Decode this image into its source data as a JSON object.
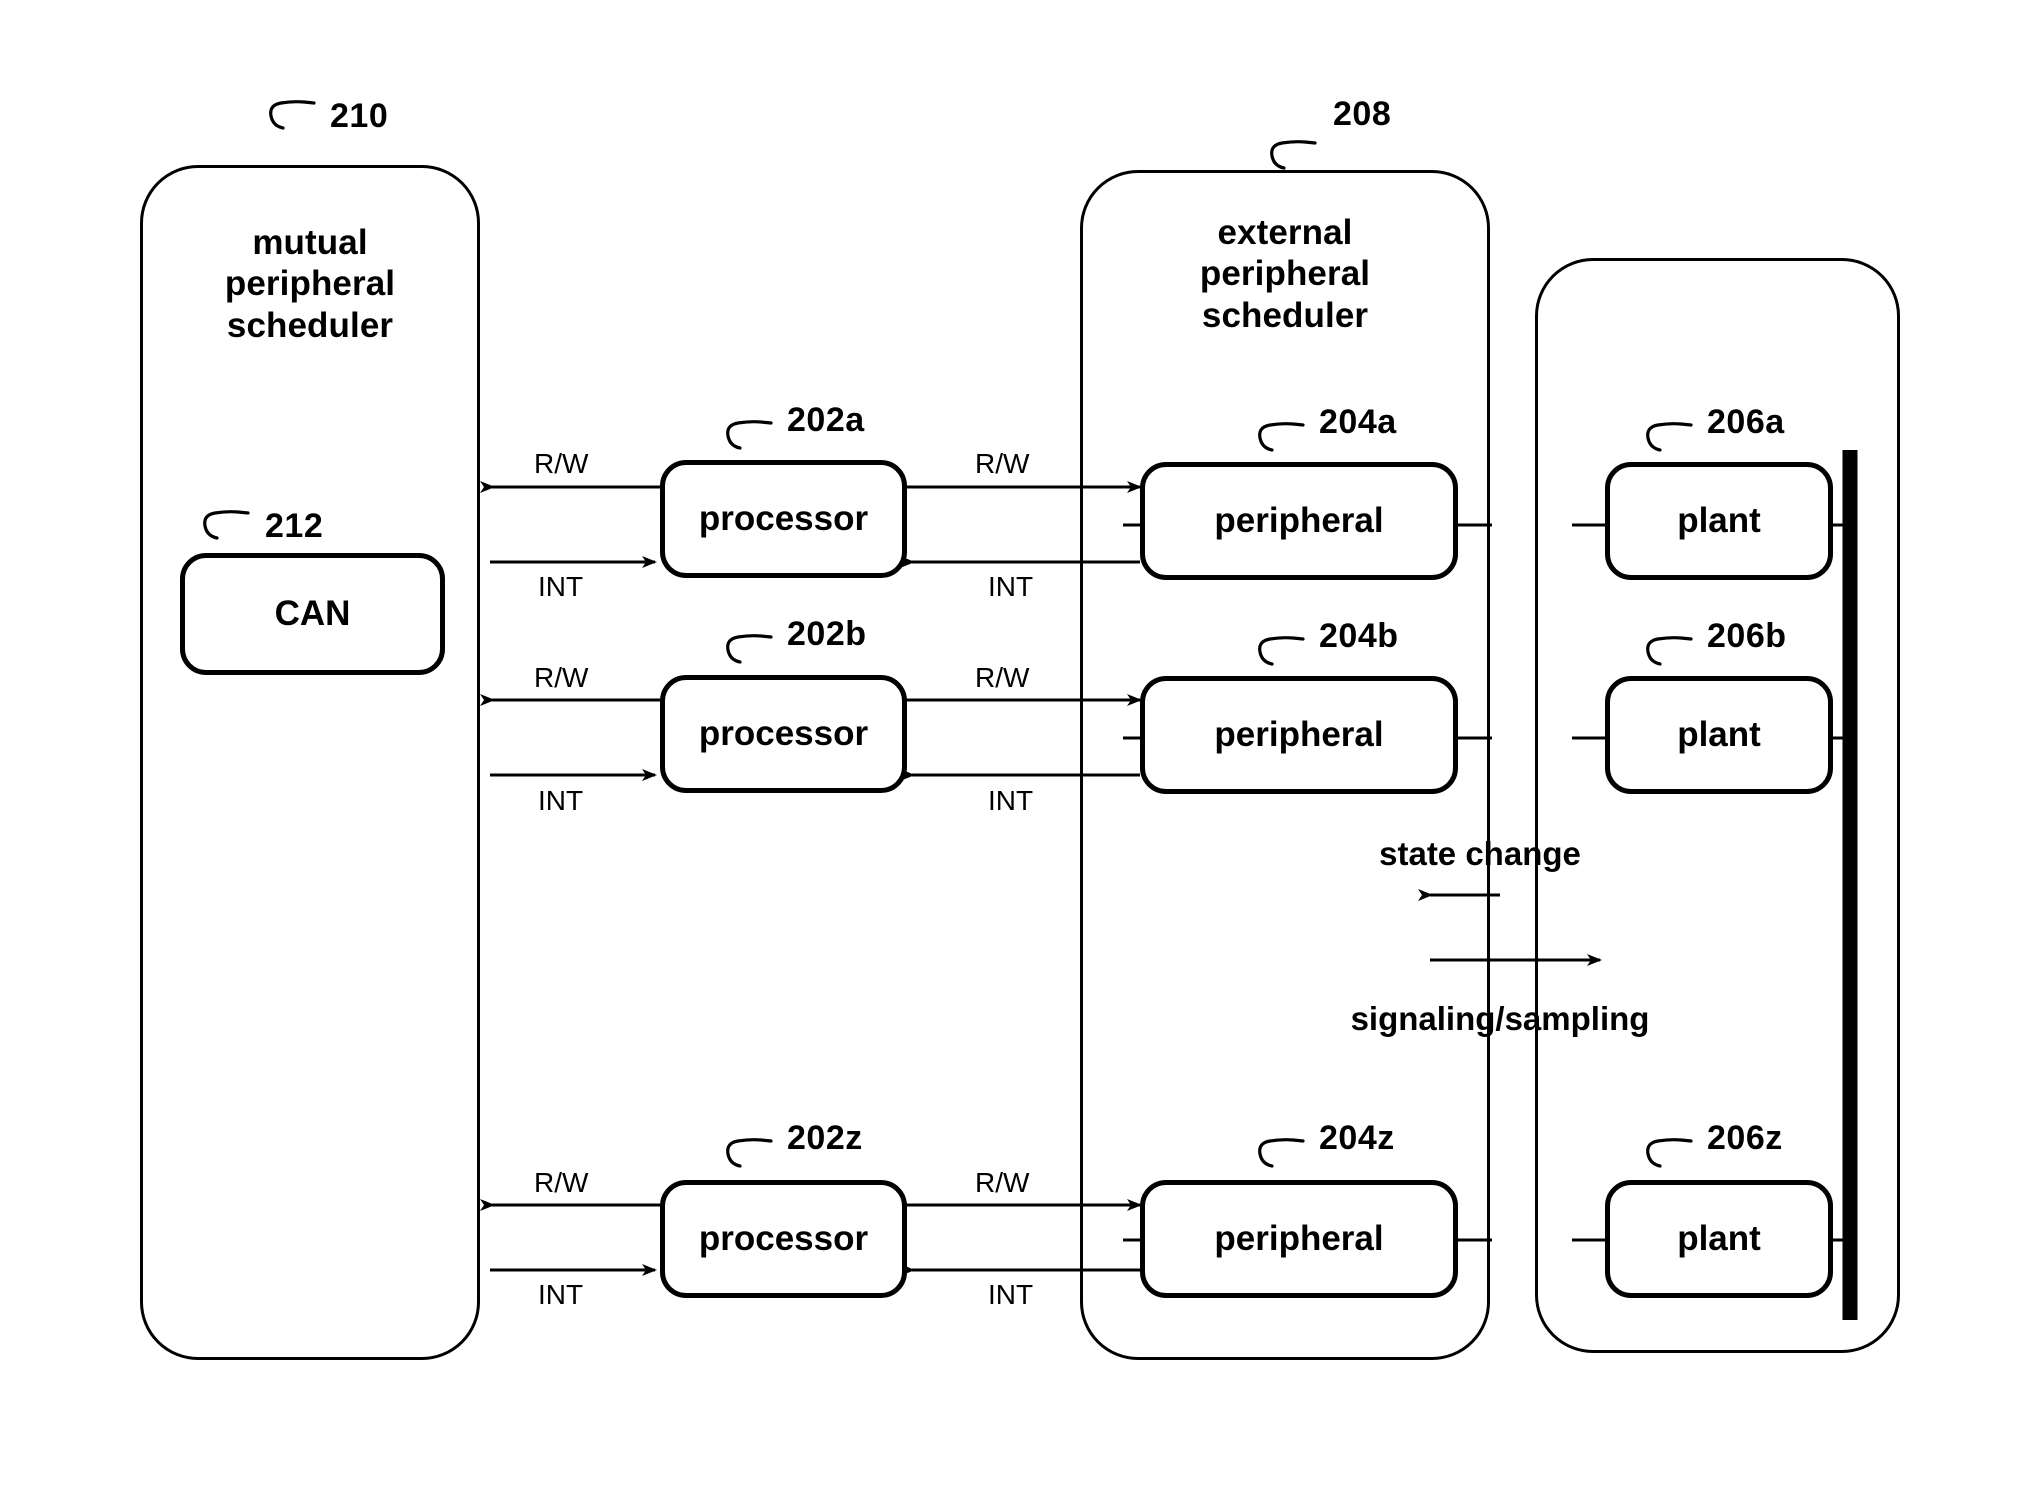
{
  "figure": {
    "background": "#ffffff",
    "ink": "#000000"
  },
  "containers": [
    {
      "id": "mutual-peripheral-scheduler",
      "ref": "210",
      "title_lines": [
        "mutual",
        "peripheral",
        "scheduler"
      ],
      "title": "mutual peripheral scheduler"
    },
    {
      "id": "external-peripheral-scheduler",
      "ref": "208",
      "title_lines": [
        "external",
        "peripheral",
        "scheduler"
      ],
      "title": "external peripheral scheduler"
    },
    {
      "id": "plant-group",
      "ref": "",
      "title_lines": [],
      "title": ""
    }
  ],
  "can": {
    "label": "CAN",
    "ref": "212"
  },
  "rows": [
    {
      "suffix": "a",
      "processor": {
        "label": "processor",
        "ref": "202a"
      },
      "peripheral": {
        "label": "peripheral",
        "ref": "204a"
      },
      "plant": {
        "label": "plant",
        "ref": "206a"
      },
      "signals": {
        "left_rw": "R/W",
        "left_int": "INT",
        "right_rw": "R/W",
        "right_int": "INT"
      }
    },
    {
      "suffix": "b",
      "processor": {
        "label": "processor",
        "ref": "202b"
      },
      "peripheral": {
        "label": "peripheral",
        "ref": "204b"
      },
      "plant": {
        "label": "plant",
        "ref": "206b"
      },
      "signals": {
        "left_rw": "R/W",
        "left_int": "INT",
        "right_rw": "R/W",
        "right_int": "INT"
      }
    },
    {
      "suffix": "z",
      "processor": {
        "label": "processor",
        "ref": "202z"
      },
      "peripheral": {
        "label": "peripheral",
        "ref": "204z"
      },
      "plant": {
        "label": "plant",
        "ref": "206z"
      },
      "signals": {
        "left_rw": "R/W",
        "left_int": "INT",
        "right_rw": "R/W",
        "right_int": "INT"
      }
    }
  ],
  "legend": {
    "state_change": "state change",
    "signaling_sampling": "signaling/sampling"
  }
}
